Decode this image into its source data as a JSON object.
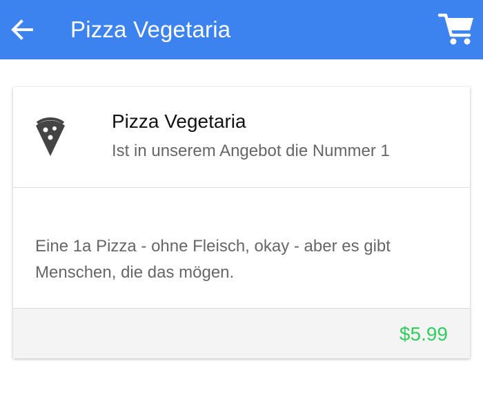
{
  "header": {
    "title": "Pizza Vegetaria",
    "back_icon": "arrow-left-icon",
    "cart_icon": "shopping-cart-icon",
    "background_color": "#3d83f0"
  },
  "card": {
    "icon": "pizza-slice-icon",
    "title": "Pizza Vegetaria",
    "subtitle": "Ist in unserem Angebot die Nummer 1",
    "description": "Eine 1a Pizza - ohne Fleisch, okay - aber es gibt Menschen, die das mögen.",
    "price": "$5.99",
    "price_color": "#33cd5f"
  }
}
